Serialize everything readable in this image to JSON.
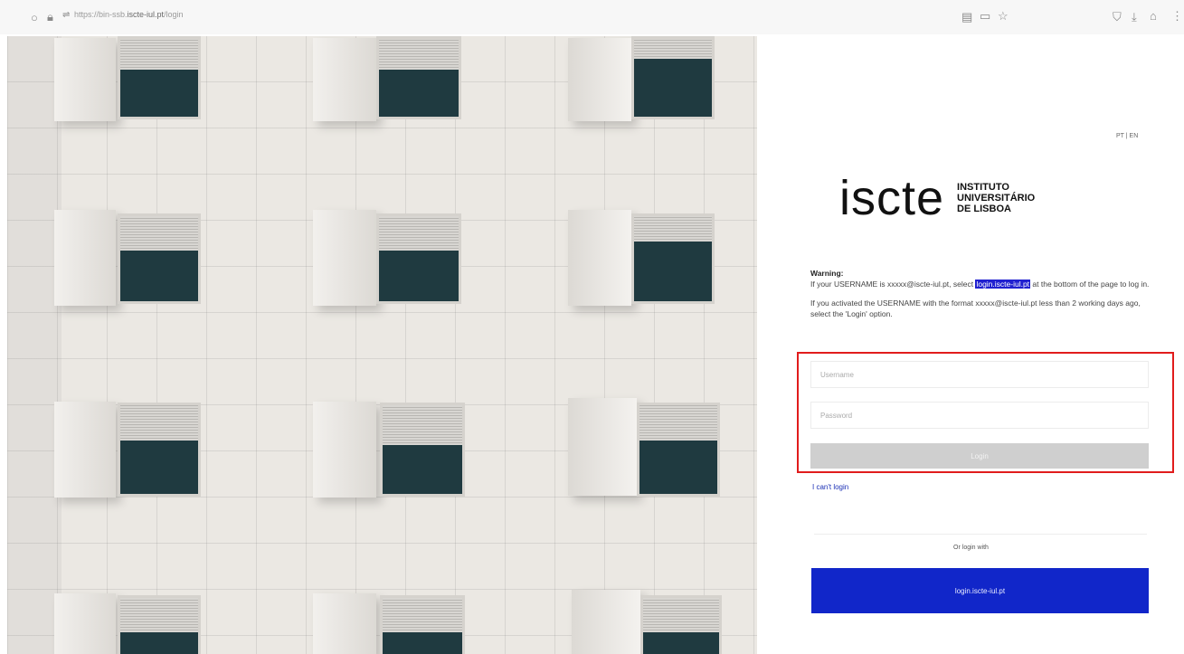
{
  "browser": {
    "url_prefix": "https://bin-ssb.",
    "url_main": "iscte-iul.pt",
    "url_suffix": "/login",
    "icons": [
      "shield-icon",
      "lock-icon",
      "permissions-icon",
      "reader-icon",
      "key-icon",
      "star-icon",
      "pocket-icon",
      "download-icon",
      "home-icon",
      "more-icon"
    ]
  },
  "lang": "PT | EN",
  "logo": {
    "word": "iscte",
    "line1": "INSTITUTO",
    "line2": "UNIVERSITÁRIO",
    "line3": "DE LISBOA"
  },
  "warning": {
    "title": "Warning:",
    "p1_before": "If your USERNAME is xxxxx@iscte-iul.pt, select ",
    "p1_link": "login.iscte-iul.pt",
    "p1_after": " at the bottom of the page to log in.",
    "p2": "If you activated the USERNAME with the format xxxxx@iscte-iul.pt less than 2 working days ago, select the 'Login' option."
  },
  "form": {
    "username_placeholder": "Username",
    "password_placeholder": "Password",
    "login_label": "Login"
  },
  "cant_login": "I can't login",
  "or_login_with": "Or login with",
  "sso_button": "login.iscte-iul.pt",
  "colors": {
    "sso_blue": "#1126c9",
    "highlight": "#e11c1c",
    "link_blue": "#1a2fb5"
  }
}
